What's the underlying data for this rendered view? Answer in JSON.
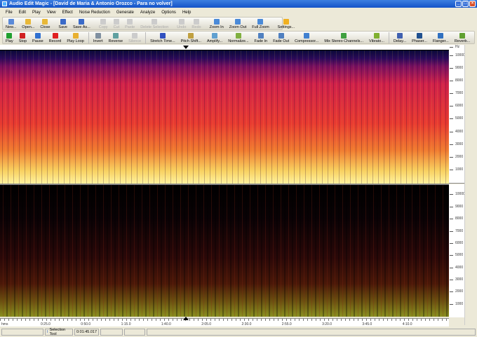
{
  "title": "Audio Edit Magic - [David de Maria & Antonio Orozco - Para no volver]",
  "menu": [
    "File",
    "Edit",
    "Play",
    "View",
    "Effect",
    "Noise Reduction",
    "Generate",
    "Analyze",
    "Options",
    "Help"
  ],
  "toolbar1": [
    {
      "label": "New...",
      "icon": "new-file-icon",
      "color": "#5a8ad8",
      "enabled": true
    },
    {
      "label": "Open...",
      "icon": "open-folder-icon",
      "color": "#e8b838",
      "enabled": true
    },
    {
      "label": "Close",
      "icon": "close-folder-icon",
      "color": "#e8b838",
      "enabled": true
    },
    {
      "label": "Save",
      "icon": "save-icon",
      "color": "#3a6ac8",
      "enabled": true
    },
    {
      "label": "Save As...",
      "icon": "save-as-icon",
      "color": "#3a6ac8",
      "enabled": true
    },
    {
      "label": "Copy",
      "icon": "copy-icon",
      "color": "#ccc",
      "enabled": false
    },
    {
      "label": "Cut",
      "icon": "cut-icon",
      "color": "#ccc",
      "enabled": false
    },
    {
      "label": "Paste",
      "icon": "paste-icon",
      "color": "#ccc",
      "enabled": false
    },
    {
      "label": "Delete Selection",
      "icon": "delete-icon",
      "color": "#ccc",
      "enabled": false
    },
    {
      "label": "Undo",
      "icon": "undo-icon",
      "color": "#ccc",
      "enabled": false
    },
    {
      "label": "Redo",
      "icon": "redo-icon",
      "color": "#ccc",
      "enabled": false
    },
    {
      "label": "Zoom In",
      "icon": "zoom-in-icon",
      "color": "#4a8ad8",
      "enabled": true
    },
    {
      "label": "Zoom Out",
      "icon": "zoom-out-icon",
      "color": "#4a8ad8",
      "enabled": true
    },
    {
      "label": "Full Zoom",
      "icon": "full-zoom-icon",
      "color": "#4a8ad8",
      "enabled": true
    },
    {
      "label": "Settings...",
      "icon": "settings-icon",
      "color": "#f0b020",
      "enabled": true
    }
  ],
  "toolbar2": [
    {
      "label": "Play",
      "icon": "play-icon",
      "color": "#20a030",
      "enabled": true
    },
    {
      "label": "Stop",
      "icon": "stop-icon",
      "color": "#d02020",
      "enabled": true
    },
    {
      "label": "Pause",
      "icon": "pause-icon",
      "color": "#3070d0",
      "enabled": true
    },
    {
      "label": "Record",
      "icon": "record-icon",
      "color": "#e02020",
      "enabled": true
    },
    {
      "label": "Play Loop",
      "icon": "play-loop-icon",
      "color": "#e8b030",
      "enabled": true
    },
    {
      "label": "Invert",
      "icon": "invert-icon",
      "color": "#8090a0",
      "enabled": true
    },
    {
      "label": "Reverse",
      "icon": "reverse-icon",
      "color": "#60a0a0",
      "enabled": true
    },
    {
      "label": "Silence",
      "icon": "silence-icon",
      "color": "#ccc",
      "enabled": false
    },
    {
      "label": "Stretch Time...",
      "icon": "stretch-time-icon",
      "color": "#3050c0",
      "enabled": true
    },
    {
      "label": "Pitch Shift...",
      "icon": "pitch-shift-icon",
      "color": "#c0a040",
      "enabled": true
    },
    {
      "label": "Amplify...",
      "icon": "amplify-icon",
      "color": "#60a0d0",
      "enabled": true
    },
    {
      "label": "Normalize...",
      "icon": "normalize-icon",
      "color": "#80b040",
      "enabled": true
    },
    {
      "label": "Fade In",
      "icon": "fade-in-icon",
      "color": "#5080c0",
      "enabled": true
    },
    {
      "label": "Fade Out",
      "icon": "fade-out-icon",
      "color": "#5080c0",
      "enabled": true
    },
    {
      "label": "Compressor...",
      "icon": "compressor-icon",
      "color": "#4080d0",
      "enabled": true
    },
    {
      "label": "Mix Stereo Channels...",
      "icon": "mix-stereo-icon",
      "color": "#40a040",
      "enabled": true
    },
    {
      "label": "Vibrato...",
      "icon": "vibrato-icon",
      "color": "#80b030",
      "enabled": true
    },
    {
      "label": "Delay...",
      "icon": "delay-icon",
      "color": "#4060b0",
      "enabled": true
    },
    {
      "label": "Phaser...",
      "icon": "phaser-icon",
      "color": "#205090",
      "enabled": true
    },
    {
      "label": "Flanger...",
      "icon": "flanger-icon",
      "color": "#3070c0",
      "enabled": true
    },
    {
      "label": "Reverb...",
      "icon": "reverb-icon",
      "color": "#60a030",
      "enabled": true
    }
  ],
  "freq_axis": {
    "unit": "Hz",
    "ticks": [
      "10000",
      "9000",
      "8000",
      "7000",
      "6000",
      "5000",
      "4000",
      "3000",
      "2000",
      "1000"
    ]
  },
  "time_axis": {
    "unit": "hms",
    "ticks": [
      "0:25.0",
      "0:50.0",
      "1:15.0",
      "1:40.0",
      "2:05.0",
      "2:30.0",
      "2:55.0",
      "3:20.0",
      "3:45.0",
      "4:10.0"
    ]
  },
  "status": {
    "tool": "Selection Tool",
    "time": "0:01:45.017"
  }
}
